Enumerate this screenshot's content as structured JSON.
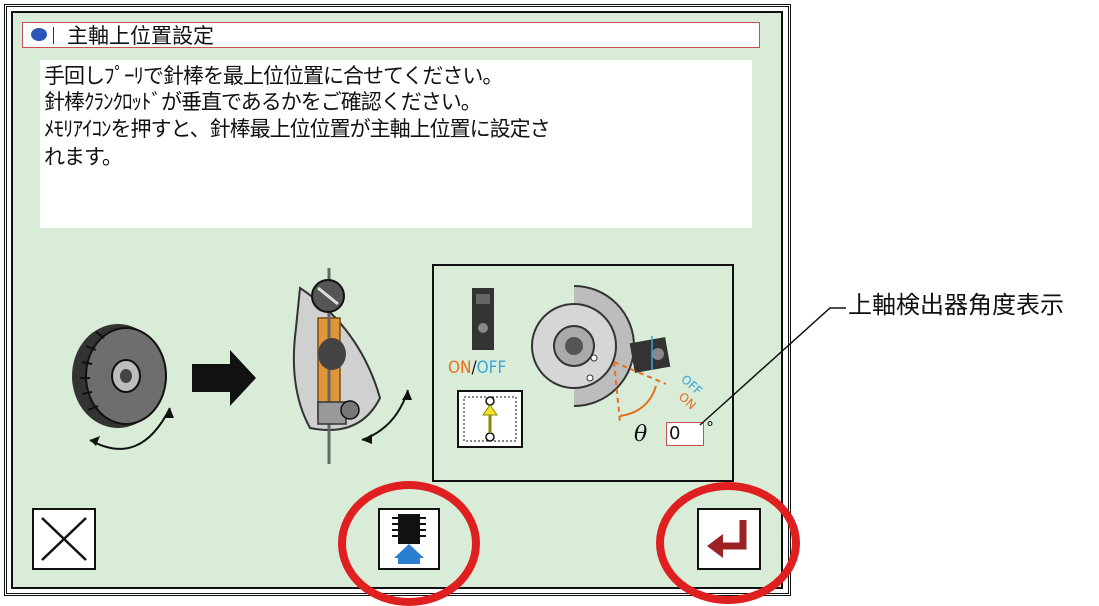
{
  "dialog": {
    "title": "主軸上位置設定",
    "message_lines": [
      "手回しﾌﾟｰﾘで針棒を最上位位置に合せてください。",
      "針棒ｸﾗﾝｸﾛｯﾄﾞが垂直であるかをご確認ください。",
      "ﾒﾓﾘｱｲｺﾝを押すと、針棒最上位位置が主軸上位置に設定さ",
      "れます。"
    ]
  },
  "sensor_panel": {
    "on_label": "ON",
    "slash": "/",
    "off_label": "OFF",
    "arc_off_label": "OFF",
    "arc_on_label": "ON",
    "theta_symbol": "θ",
    "angle_value": "0",
    "angle_unit": "°"
  },
  "annotation": {
    "callout_text": "上軸検出器角度表示"
  },
  "colors": {
    "panel_bg": "#d8ecd8",
    "highlight_ring": "#e02020",
    "enter_icon": "#9b2323",
    "memory_arrow": "#2a7fd0"
  }
}
